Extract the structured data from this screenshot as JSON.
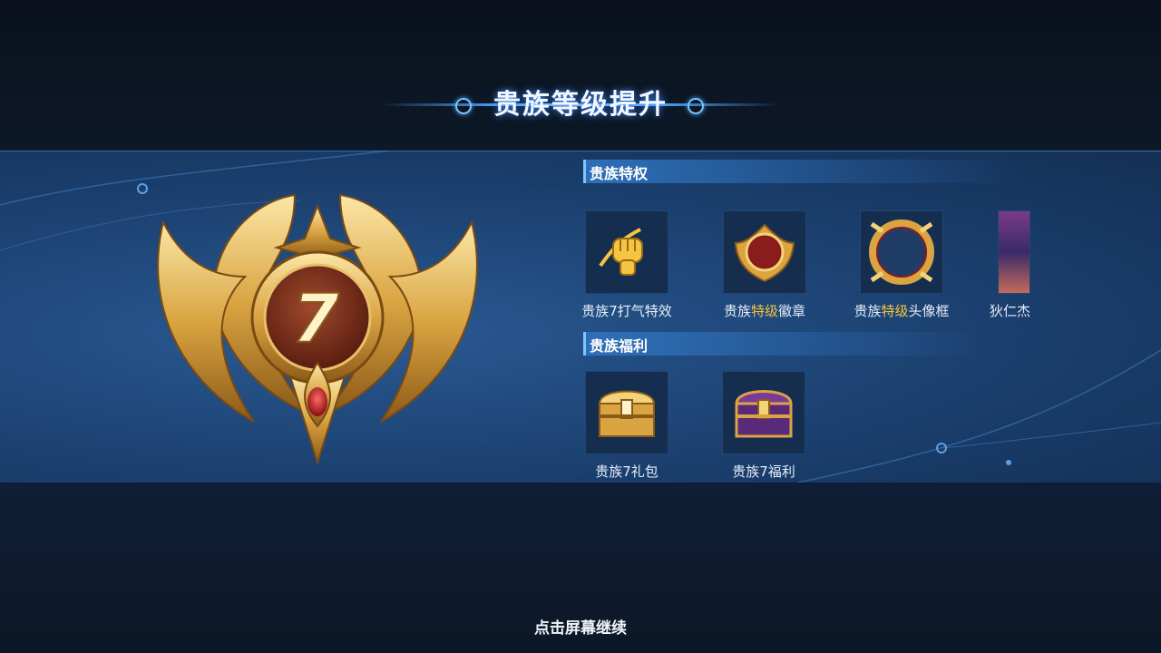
{
  "header": {
    "title": "贵族等级提升"
  },
  "badge": {
    "level": "7"
  },
  "privileges": {
    "title": "贵族特权",
    "items": [
      {
        "pre": "贵族7打气特效",
        "hl": "",
        "post": "",
        "icon": "fist-icon"
      },
      {
        "pre": "贵族",
        "hl": "特级",
        "post": "徽章",
        "icon": "badge-icon"
      },
      {
        "pre": "贵族",
        "hl": "特级",
        "post": "头像框",
        "icon": "avatar-frame-icon"
      },
      {
        "pre": "狄仁杰",
        "hl": "",
        "post": "",
        "icon": "hero-skin-icon"
      }
    ]
  },
  "benefits": {
    "title": "贵族福利",
    "items": [
      {
        "label": "贵族7礼包",
        "icon": "gold-chest-icon"
      },
      {
        "label": "贵族7福利",
        "icon": "purple-chest-icon"
      }
    ]
  },
  "footer": {
    "continue": "点击屏幕继续"
  },
  "colors": {
    "highlight": "#f5c542",
    "panel": "#20497c",
    "accent": "#4aa6ff"
  }
}
